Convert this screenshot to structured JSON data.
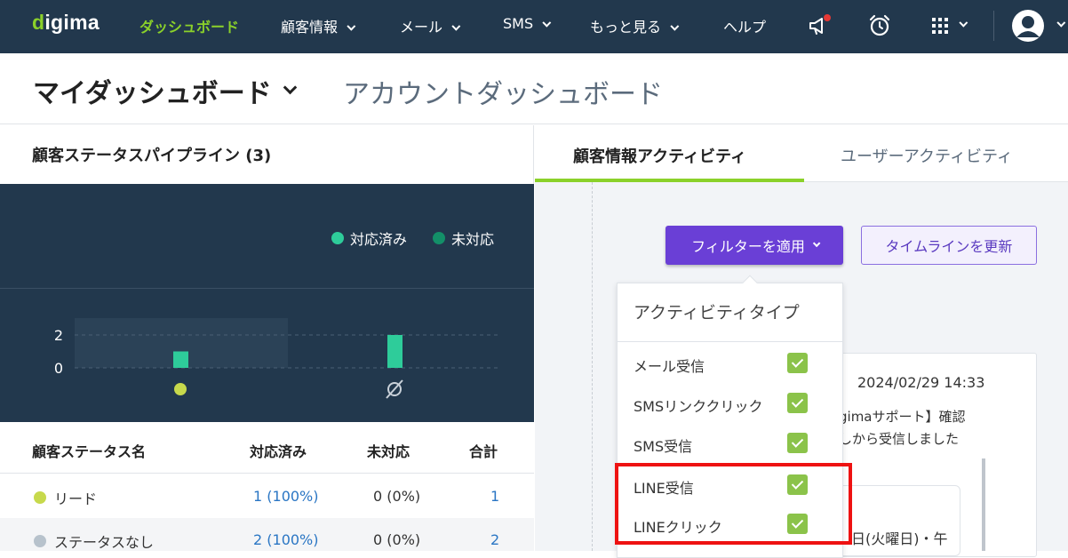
{
  "nav": {
    "logo": "digima",
    "items": [
      "ダッシュボード",
      "顧客情報",
      "メール",
      "SMS",
      "もっと見る",
      "ヘルプ"
    ],
    "colors": {
      "bg": "#22384d",
      "active": "#8bd12a"
    }
  },
  "header": {
    "title": "マイダッシュボード",
    "alt_title": "アカウントダッシュボード"
  },
  "pipeline": {
    "title": "顧客ステータスパイプライン (3)",
    "legend": [
      {
        "label": "対応済み",
        "color": "#2ecc9a"
      },
      {
        "label": "未対応",
        "color": "#138f68"
      }
    ],
    "chart_data": {
      "type": "bar",
      "categories": [
        "リード",
        "ステータスなし"
      ],
      "series": [
        {
          "name": "対応済み",
          "values": [
            1,
            2
          ]
        },
        {
          "name": "未対応",
          "values": [
            0,
            0
          ]
        }
      ],
      "yticks": [
        "2",
        "0"
      ],
      "ylim": [
        0,
        2
      ],
      "category_icons": [
        "dot-yellow-green",
        "empty-set"
      ]
    },
    "table": {
      "columns": [
        "顧客ステータス名",
        "対応済み",
        "未対応",
        "合計"
      ],
      "rows": [
        {
          "name": "リード",
          "dot_color": "#c7d94c",
          "done": "1 (100%)",
          "pending": "0 (0%)",
          "total": "1"
        },
        {
          "name": "ステータスなし",
          "dot_color": "#b7c2cc",
          "done": "2 (100%)",
          "pending": "0 (0%)",
          "total": "2"
        }
      ]
    }
  },
  "activity": {
    "tabs": [
      "顧客情報アクティビティ",
      "ユーザーアクティビティ"
    ],
    "filter_button": "フィルターを適用",
    "refresh_button": "タイムラインを更新",
    "dropdown": {
      "title": "アクティビティタイプ",
      "items": [
        "メール受信",
        "SMSリンククリック",
        "SMS受信",
        "LINE受信",
        "LINEクリック"
      ]
    },
    "card": {
      "date": "2024/02/29 14:33",
      "line1": "gimaサポート】確認",
      "line2": "しから受信しました",
      "line3": "日(火曜日)・午"
    }
  }
}
